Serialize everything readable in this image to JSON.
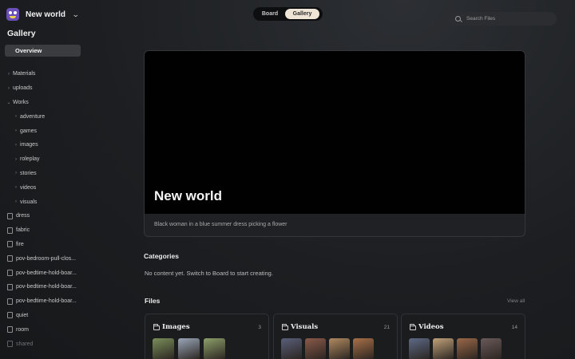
{
  "workspace": {
    "name": "New world"
  },
  "sidebar": {
    "section_title": "Gallery",
    "overview_label": "Overview",
    "tree": [
      {
        "label": "Materials",
        "kind": "folder",
        "level": 0,
        "expanded": false
      },
      {
        "label": "uploads",
        "kind": "folder",
        "level": 0,
        "expanded": false
      },
      {
        "label": "Works",
        "kind": "folder",
        "level": 0,
        "expanded": true
      },
      {
        "label": "adventure",
        "kind": "folder",
        "level": 1,
        "expanded": false
      },
      {
        "label": "games",
        "kind": "folder",
        "level": 1,
        "expanded": false
      },
      {
        "label": "images",
        "kind": "folder",
        "level": 1,
        "expanded": false
      },
      {
        "label": "roleplay",
        "kind": "folder",
        "level": 1,
        "expanded": false
      },
      {
        "label": "stories",
        "kind": "folder",
        "level": 1,
        "expanded": false
      },
      {
        "label": "videos",
        "kind": "folder",
        "level": 1,
        "expanded": false
      },
      {
        "label": "visuals",
        "kind": "folder",
        "level": 1,
        "expanded": false
      },
      {
        "label": "dress",
        "kind": "file"
      },
      {
        "label": "fabric",
        "kind": "file"
      },
      {
        "label": "fire",
        "kind": "file"
      },
      {
        "label": "pov-bedroom-pull-clos...",
        "kind": "file"
      },
      {
        "label": "pov-bedtime-hold-boar...",
        "kind": "file"
      },
      {
        "label": "pov-bedtime-hold-boar...",
        "kind": "file"
      },
      {
        "label": "pov-bedtime-hold-boar...",
        "kind": "file"
      },
      {
        "label": "quiet",
        "kind": "file"
      },
      {
        "label": "room",
        "kind": "file"
      },
      {
        "label": "shared",
        "kind": "file",
        "muted": true
      }
    ]
  },
  "view_toggle": {
    "board_label": "Board",
    "gallery_label": "Gallery",
    "active": "Gallery"
  },
  "search": {
    "placeholder": "Search Files"
  },
  "hero": {
    "title": "New world",
    "caption": "Black woman in a blue summer dress picking a flower"
  },
  "categories": {
    "title": "Categories",
    "empty_message": "No content yet. Switch to Board to start creating."
  },
  "files": {
    "title": "Files",
    "view_all_label": "View all",
    "cards": [
      {
        "title": "Images",
        "count": "3",
        "thumb_colors": [
          "#7a8f5a",
          "#9aa7b8",
          "#8da06a"
        ]
      },
      {
        "title": "Visuals",
        "count": "21",
        "thumb_colors": [
          "#5a5f7a",
          "#8a5a4a",
          "#b08a60",
          "#a87048"
        ]
      },
      {
        "title": "Videos",
        "count": "14",
        "thumb_colors": [
          "#5d6a86",
          "#c0a27a",
          "#9a6848",
          "#6a5a5a"
        ]
      }
    ]
  }
}
